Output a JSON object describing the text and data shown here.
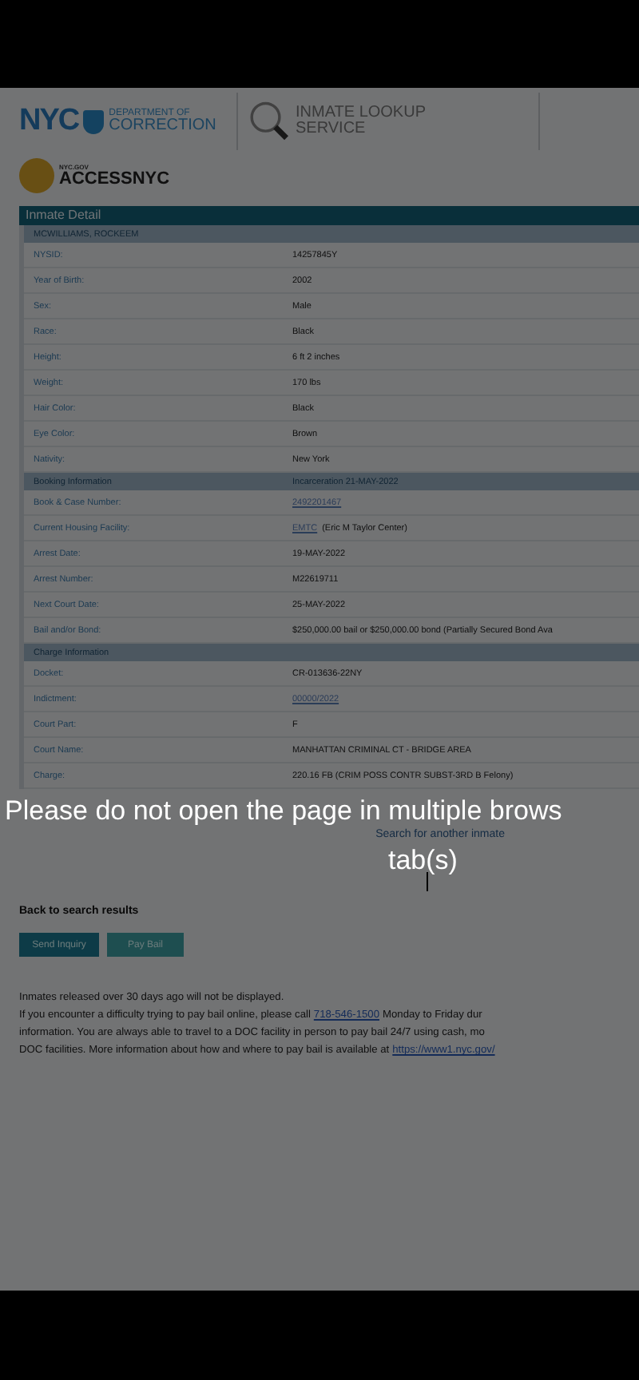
{
  "header": {
    "nyc_logo": "NYC",
    "department": [
      "DEPARTMENT OF",
      "CORRECTION"
    ],
    "service": [
      "INMATE LOOKUP",
      "SERVICE"
    ],
    "access_small": "NYC.GOV",
    "access_name": "ACCESSNYC"
  },
  "panel_title": "Inmate Detail",
  "sections": [
    {
      "title": "MCWILLIAMS, ROCKEEM",
      "rows": [
        {
          "label": "NYSID:",
          "parts": [
            {
              "text": "14257845Y",
              "link": false
            }
          ]
        },
        {
          "label": "Year of Birth:",
          "parts": [
            {
              "text": "2002",
              "link": false
            }
          ]
        },
        {
          "label": "Sex:",
          "parts": [
            {
              "text": "Male",
              "link": false
            }
          ]
        },
        {
          "label": "Race:",
          "parts": [
            {
              "text": "Black",
              "link": false
            }
          ]
        },
        {
          "label": "Height:",
          "parts": [
            {
              "text": "6 ft 2 inches",
              "link": false
            }
          ]
        },
        {
          "label": "Weight:",
          "parts": [
            {
              "text": "170 lbs",
              "link": false
            }
          ]
        },
        {
          "label": "Hair Color:",
          "parts": [
            {
              "text": "Black",
              "link": false
            }
          ]
        },
        {
          "label": "Eye Color:",
          "parts": [
            {
              "text": "Brown",
              "link": false
            }
          ]
        },
        {
          "label": "Nativity:",
          "parts": [
            {
              "text": "New York",
              "link": false
            }
          ]
        }
      ]
    },
    {
      "title": "Booking Information",
      "value": "Incarceration 21-MAY-2022",
      "rows": [
        {
          "label": "Book & Case Number:",
          "parts": [
            {
              "text": "2492201467",
              "link": true
            }
          ]
        },
        {
          "label": "Current Housing Facility:",
          "parts": [
            {
              "text": "EMTC",
              "link": true
            },
            {
              "text": "(Eric M Taylor Center)",
              "link": false
            }
          ]
        },
        {
          "label": "Arrest Date:",
          "parts": [
            {
              "text": "19-MAY-2022",
              "link": false
            }
          ]
        },
        {
          "label": "Arrest Number:",
          "parts": [
            {
              "text": "M22619711",
              "link": false
            }
          ]
        },
        {
          "label": "Next Court Date:",
          "parts": [
            {
              "text": "25-MAY-2022",
              "link": false
            }
          ]
        },
        {
          "label": "Bail and/or Bond:",
          "parts": [
            {
              "text": "$250,000.00 bail or $250,000.00 bond (Partially Secured Bond Ava",
              "link": false
            }
          ]
        }
      ]
    },
    {
      "title": "Charge Information",
      "rows": [
        {
          "label": "Docket:",
          "parts": [
            {
              "text": "CR-013636-22NY",
              "link": false
            }
          ]
        },
        {
          "label": "Indictment:",
          "parts": [
            {
              "text": "00000/2022",
              "link": true
            }
          ]
        },
        {
          "label": "Court Part:",
          "parts": [
            {
              "text": "F",
              "link": false
            }
          ]
        },
        {
          "label": "Court Name:",
          "parts": [
            {
              "text": "MANHATTAN CRIMINAL CT - BRIDGE AREA",
              "link": false
            }
          ]
        },
        {
          "label": "Charge:",
          "parts": [
            {
              "text": "220.16 FB (CRIM POSS CONTR SUBST-3RD B Felony)",
              "link": false
            }
          ]
        }
      ]
    }
  ],
  "search_link": "Search for another inmate",
  "back_link": "Back to search results",
  "buttons": [
    {
      "label": "Send Inquiry",
      "kind": "primary"
    },
    {
      "label": "Pay Bail",
      "kind": "secondary"
    }
  ],
  "notice_lines": [
    [
      {
        "text": "Inmates released over 30 days ago will not be displayed.",
        "link": false
      }
    ],
    [
      {
        "text": "If you encounter a difficulty trying to pay bail online, please call",
        "link": false
      },
      {
        "text": "718-546-1500",
        "link": true
      },
      {
        "text": "Monday to Friday dur",
        "link": false
      }
    ],
    [
      {
        "text": "information. You are always able to travel to a DOC facility in person to pay bail 24/7 using cash, mo",
        "link": false
      }
    ],
    [
      {
        "text": "DOC facilities. More information about how and where to pay bail is available at",
        "link": false
      },
      {
        "text": "https://www1.nyc.gov/",
        "link": true
      }
    ]
  ],
  "overlay_message": [
    "Please do not open the page in multiple brows",
    "tab(s)"
  ]
}
